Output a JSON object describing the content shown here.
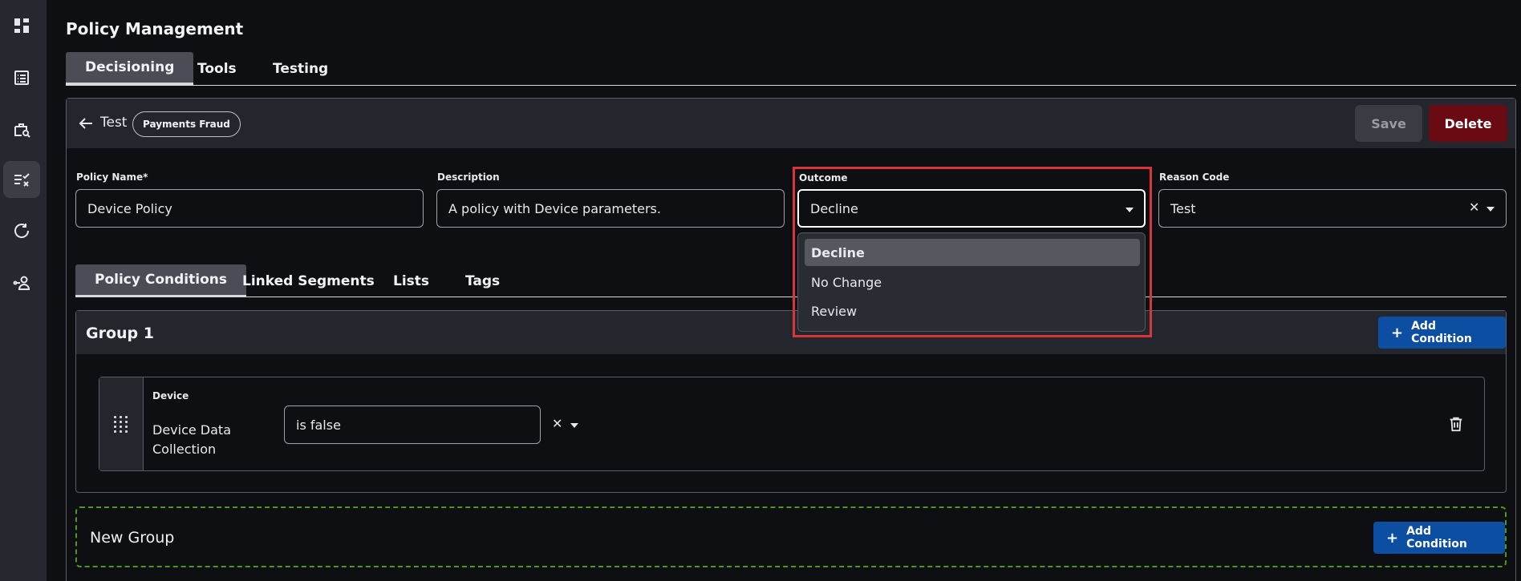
{
  "page": {
    "title": "Policy Management"
  },
  "top_tabs": [
    {
      "label": "Decisioning",
      "active": true
    },
    {
      "label": "Tools",
      "active": false
    },
    {
      "label": "Testing",
      "active": false
    }
  ],
  "sidebar": {
    "items": [
      {
        "icon": "dashboard-icon",
        "active": false
      },
      {
        "icon": "list-icon",
        "active": false
      },
      {
        "icon": "briefcase-search-icon",
        "active": false
      },
      {
        "icon": "rules-icon",
        "active": true
      },
      {
        "icon": "refresh-icon",
        "active": false
      },
      {
        "icon": "user-link-icon",
        "active": false
      }
    ]
  },
  "policy": {
    "header_name": "Test",
    "chip": "Payments Fraud",
    "save_label": "Save",
    "delete_label": "Delete"
  },
  "form": {
    "policy_name_label": "Policy Name*",
    "policy_name_value": "Device Policy",
    "description_label": "Description",
    "description_value": "A policy with Device parameters.",
    "outcome_label": "Outcome",
    "outcome_value": "Decline",
    "reason_code_label": "Reason Code",
    "reason_code_value": "Test"
  },
  "outcome_options": [
    {
      "label": "Decline",
      "selected": true
    },
    {
      "label": "No Change",
      "selected": false
    },
    {
      "label": "Review",
      "selected": false
    }
  ],
  "sub_tabs": [
    {
      "label": "Policy Conditions",
      "active": true
    },
    {
      "label": "Linked Segments",
      "active": false
    },
    {
      "label": "Lists",
      "active": false
    },
    {
      "label": "Tags",
      "active": false
    }
  ],
  "group": {
    "title": "Group 1",
    "add_label": "Add Condition",
    "condition": {
      "category": "Device",
      "name": "Device Data Collection",
      "operator": "is false"
    }
  },
  "new_group": {
    "title": "New Group",
    "add_label": "Add Condition"
  },
  "colors": {
    "accent_blue": "#0b4ea2",
    "delete_red": "#6a0a12",
    "highlight_red": "#d9343a",
    "dashed_green": "#4a9a1e"
  }
}
